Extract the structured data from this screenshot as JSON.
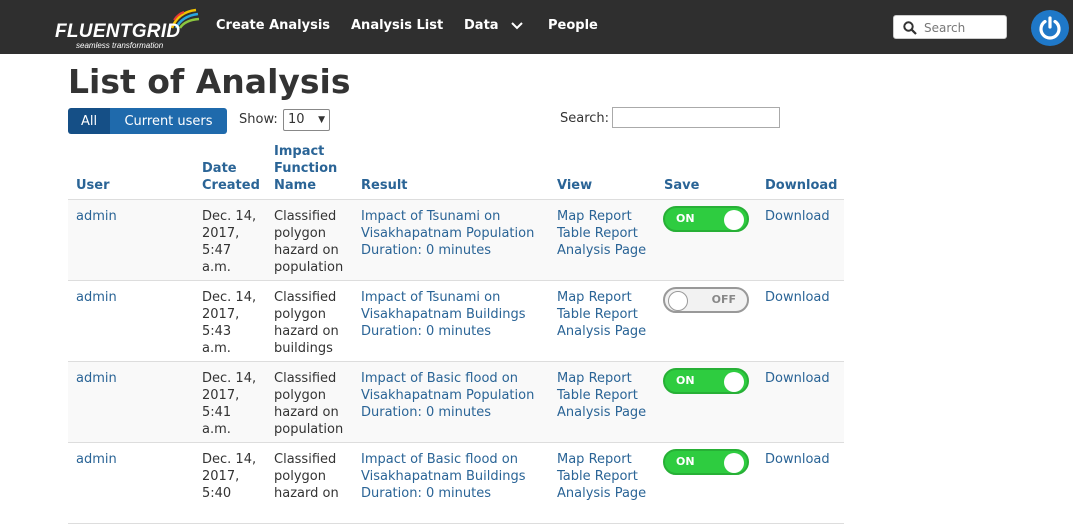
{
  "brand": {
    "name": "FLUENTGRID",
    "tagline": "seamless transformation"
  },
  "nav": {
    "items": [
      "Create Analysis",
      "Analysis List",
      "Data",
      "People"
    ],
    "search_placeholder": "Search"
  },
  "page": {
    "title": "List of Analysis",
    "filter_all": "All",
    "filter_current": "Current users",
    "show_label": "Show:",
    "show_value": "10",
    "search_label": "Search:"
  },
  "table": {
    "headers": {
      "user": "User",
      "date_1": "Date",
      "date_2": "Created",
      "func_1": "Impact",
      "func_2": "Function",
      "func_3": "Name",
      "result": "Result",
      "view": "View",
      "save": "Save",
      "download": "Download"
    },
    "rows": [
      {
        "user": "admin",
        "date": [
          "Dec. 14,",
          "2017,",
          "5:47",
          "a.m."
        ],
        "func": [
          "Classified",
          "polygon",
          "hazard on",
          "population"
        ],
        "result": [
          "Impact of Tsunami on",
          "Visakhapatnam Population",
          "Duration: 0 minutes"
        ],
        "view": [
          "Map Report",
          "Table Report",
          "Analysis Page"
        ],
        "save": "ON",
        "download": "Download"
      },
      {
        "user": "admin",
        "date": [
          "Dec. 14,",
          "2017,",
          "5:43",
          "a.m."
        ],
        "func": [
          "Classified",
          "polygon",
          "hazard on",
          "buildings"
        ],
        "result": [
          "Impact of Tsunami on",
          "Visakhapatnam Buildings",
          "Duration: 0 minutes"
        ],
        "view": [
          "Map Report",
          "Table Report",
          "Analysis Page"
        ],
        "save": "OFF",
        "download": "Download"
      },
      {
        "user": "admin",
        "date": [
          "Dec. 14,",
          "2017,",
          "5:41",
          "a.m."
        ],
        "func": [
          "Classified",
          "polygon",
          "hazard on",
          "population"
        ],
        "result": [
          "Impact of Basic flood on",
          "Visakhapatnam Population",
          "Duration: 0 minutes"
        ],
        "view": [
          "Map Report",
          "Table Report",
          "Analysis Page"
        ],
        "save": "ON",
        "download": "Download"
      },
      {
        "user": "admin",
        "date": [
          "Dec. 14,",
          "2017,",
          "5:40"
        ],
        "func": [
          "Classified",
          "polygon",
          "hazard on"
        ],
        "result": [
          "Impact of Basic flood on",
          "Visakhapatnam Buildings",
          "Duration: 0 minutes"
        ],
        "view": [
          "Map Report",
          "Table Report",
          "Analysis Page"
        ],
        "save": "ON",
        "download": "Download"
      }
    ]
  },
  "colors": {
    "navbar": "#2f2f2f",
    "link": "#2a6496",
    "toggle_on": "#2ecc40",
    "button_primary": "#1f6aac"
  }
}
